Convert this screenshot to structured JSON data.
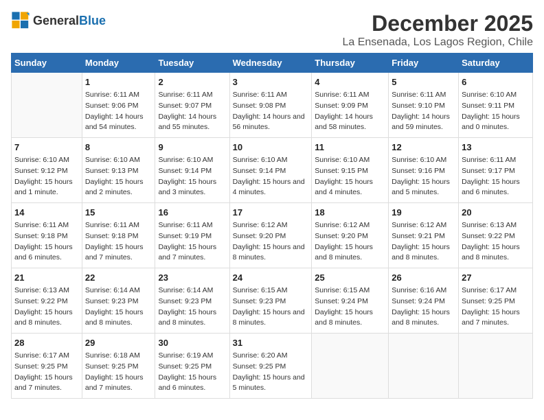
{
  "logo": {
    "general": "General",
    "blue": "Blue"
  },
  "title": "December 2025",
  "subtitle": "La Ensenada, Los Lagos Region, Chile",
  "headers": [
    "Sunday",
    "Monday",
    "Tuesday",
    "Wednesday",
    "Thursday",
    "Friday",
    "Saturday"
  ],
  "weeks": [
    [
      {
        "day": "",
        "sunrise": "",
        "sunset": "",
        "daylight": ""
      },
      {
        "day": "1",
        "sunrise": "Sunrise: 6:11 AM",
        "sunset": "Sunset: 9:06 PM",
        "daylight": "Daylight: 14 hours and 54 minutes."
      },
      {
        "day": "2",
        "sunrise": "Sunrise: 6:11 AM",
        "sunset": "Sunset: 9:07 PM",
        "daylight": "Daylight: 14 hours and 55 minutes."
      },
      {
        "day": "3",
        "sunrise": "Sunrise: 6:11 AM",
        "sunset": "Sunset: 9:08 PM",
        "daylight": "Daylight: 14 hours and 56 minutes."
      },
      {
        "day": "4",
        "sunrise": "Sunrise: 6:11 AM",
        "sunset": "Sunset: 9:09 PM",
        "daylight": "Daylight: 14 hours and 58 minutes."
      },
      {
        "day": "5",
        "sunrise": "Sunrise: 6:11 AM",
        "sunset": "Sunset: 9:10 PM",
        "daylight": "Daylight: 14 hours and 59 minutes."
      },
      {
        "day": "6",
        "sunrise": "Sunrise: 6:10 AM",
        "sunset": "Sunset: 9:11 PM",
        "daylight": "Daylight: 15 hours and 0 minutes."
      }
    ],
    [
      {
        "day": "7",
        "sunrise": "Sunrise: 6:10 AM",
        "sunset": "Sunset: 9:12 PM",
        "daylight": "Daylight: 15 hours and 1 minute."
      },
      {
        "day": "8",
        "sunrise": "Sunrise: 6:10 AM",
        "sunset": "Sunset: 9:13 PM",
        "daylight": "Daylight: 15 hours and 2 minutes."
      },
      {
        "day": "9",
        "sunrise": "Sunrise: 6:10 AM",
        "sunset": "Sunset: 9:14 PM",
        "daylight": "Daylight: 15 hours and 3 minutes."
      },
      {
        "day": "10",
        "sunrise": "Sunrise: 6:10 AM",
        "sunset": "Sunset: 9:14 PM",
        "daylight": "Daylight: 15 hours and 4 minutes."
      },
      {
        "day": "11",
        "sunrise": "Sunrise: 6:10 AM",
        "sunset": "Sunset: 9:15 PM",
        "daylight": "Daylight: 15 hours and 4 minutes."
      },
      {
        "day": "12",
        "sunrise": "Sunrise: 6:10 AM",
        "sunset": "Sunset: 9:16 PM",
        "daylight": "Daylight: 15 hours and 5 minutes."
      },
      {
        "day": "13",
        "sunrise": "Sunrise: 6:11 AM",
        "sunset": "Sunset: 9:17 PM",
        "daylight": "Daylight: 15 hours and 6 minutes."
      }
    ],
    [
      {
        "day": "14",
        "sunrise": "Sunrise: 6:11 AM",
        "sunset": "Sunset: 9:18 PM",
        "daylight": "Daylight: 15 hours and 6 minutes."
      },
      {
        "day": "15",
        "sunrise": "Sunrise: 6:11 AM",
        "sunset": "Sunset: 9:18 PM",
        "daylight": "Daylight: 15 hours and 7 minutes."
      },
      {
        "day": "16",
        "sunrise": "Sunrise: 6:11 AM",
        "sunset": "Sunset: 9:19 PM",
        "daylight": "Daylight: 15 hours and 7 minutes."
      },
      {
        "day": "17",
        "sunrise": "Sunrise: 6:12 AM",
        "sunset": "Sunset: 9:20 PM",
        "daylight": "Daylight: 15 hours and 8 minutes."
      },
      {
        "day": "18",
        "sunrise": "Sunrise: 6:12 AM",
        "sunset": "Sunset: 9:20 PM",
        "daylight": "Daylight: 15 hours and 8 minutes."
      },
      {
        "day": "19",
        "sunrise": "Sunrise: 6:12 AM",
        "sunset": "Sunset: 9:21 PM",
        "daylight": "Daylight: 15 hours and 8 minutes."
      },
      {
        "day": "20",
        "sunrise": "Sunrise: 6:13 AM",
        "sunset": "Sunset: 9:22 PM",
        "daylight": "Daylight: 15 hours and 8 minutes."
      }
    ],
    [
      {
        "day": "21",
        "sunrise": "Sunrise: 6:13 AM",
        "sunset": "Sunset: 9:22 PM",
        "daylight": "Daylight: 15 hours and 8 minutes."
      },
      {
        "day": "22",
        "sunrise": "Sunrise: 6:14 AM",
        "sunset": "Sunset: 9:23 PM",
        "daylight": "Daylight: 15 hours and 8 minutes."
      },
      {
        "day": "23",
        "sunrise": "Sunrise: 6:14 AM",
        "sunset": "Sunset: 9:23 PM",
        "daylight": "Daylight: 15 hours and 8 minutes."
      },
      {
        "day": "24",
        "sunrise": "Sunrise: 6:15 AM",
        "sunset": "Sunset: 9:23 PM",
        "daylight": "Daylight: 15 hours and 8 minutes."
      },
      {
        "day": "25",
        "sunrise": "Sunrise: 6:15 AM",
        "sunset": "Sunset: 9:24 PM",
        "daylight": "Daylight: 15 hours and 8 minutes."
      },
      {
        "day": "26",
        "sunrise": "Sunrise: 6:16 AM",
        "sunset": "Sunset: 9:24 PM",
        "daylight": "Daylight: 15 hours and 8 minutes."
      },
      {
        "day": "27",
        "sunrise": "Sunrise: 6:17 AM",
        "sunset": "Sunset: 9:25 PM",
        "daylight": "Daylight: 15 hours and 7 minutes."
      }
    ],
    [
      {
        "day": "28",
        "sunrise": "Sunrise: 6:17 AM",
        "sunset": "Sunset: 9:25 PM",
        "daylight": "Daylight: 15 hours and 7 minutes."
      },
      {
        "day": "29",
        "sunrise": "Sunrise: 6:18 AM",
        "sunset": "Sunset: 9:25 PM",
        "daylight": "Daylight: 15 hours and 7 minutes."
      },
      {
        "day": "30",
        "sunrise": "Sunrise: 6:19 AM",
        "sunset": "Sunset: 9:25 PM",
        "daylight": "Daylight: 15 hours and 6 minutes."
      },
      {
        "day": "31",
        "sunrise": "Sunrise: 6:20 AM",
        "sunset": "Sunset: 9:25 PM",
        "daylight": "Daylight: 15 hours and 5 minutes."
      },
      {
        "day": "",
        "sunrise": "",
        "sunset": "",
        "daylight": ""
      },
      {
        "day": "",
        "sunrise": "",
        "sunset": "",
        "daylight": ""
      },
      {
        "day": "",
        "sunrise": "",
        "sunset": "",
        "daylight": ""
      }
    ]
  ]
}
